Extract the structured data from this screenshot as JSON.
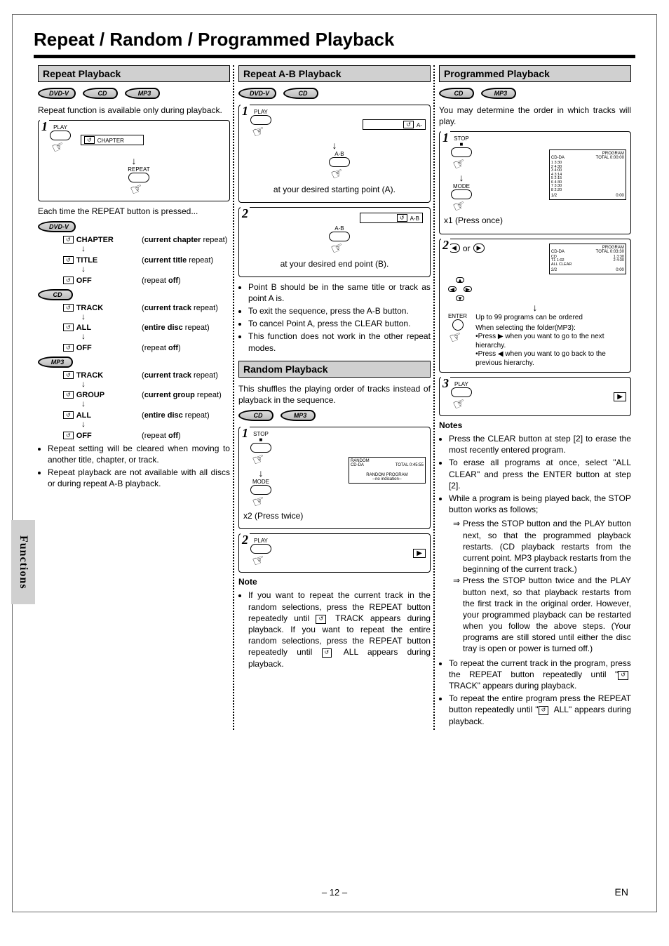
{
  "page": {
    "title": "Repeat / Random / Programmed Playback",
    "number": "– 12 –",
    "lang": "EN"
  },
  "side_tab": "Functions",
  "badges": {
    "dvdv": "DVD-V",
    "cd": "CD",
    "mp3": "MP3"
  },
  "col1": {
    "header": "Repeat Playback",
    "intro": "Repeat function is available only during playback.",
    "btn_play": "PLAY",
    "btn_repeat": "REPEAT",
    "osd_chapter": "CHAPTER",
    "after_press": "Each time the REPEAT button is pressed...",
    "dvd_seq": [
      {
        "tag": "CHAPTER",
        "desc": "(current chapter repeat)"
      },
      {
        "tag": "TITLE",
        "desc": "(current title repeat)"
      },
      {
        "tag": "OFF",
        "desc": "(repeat off)"
      }
    ],
    "cd_seq": [
      {
        "tag": "TRACK",
        "desc": "(current track repeat)"
      },
      {
        "tag": "ALL",
        "desc": "(entire disc repeat)"
      },
      {
        "tag": "OFF",
        "desc": "(repeat off)"
      }
    ],
    "mp3_seq": [
      {
        "tag": "TRACK",
        "desc": "(current track repeat)"
      },
      {
        "tag": "GROUP",
        "desc": "(current group repeat)"
      },
      {
        "tag": "ALL",
        "desc": "(entire disc repeat)"
      },
      {
        "tag": "OFF",
        "desc": "(repeat off)"
      }
    ],
    "notes": [
      "Repeat setting will be cleared when moving to another title, chapter, or track.",
      "Repeat playback are not available with all discs or during repeat A-B playback."
    ]
  },
  "col2": {
    "header_ab": "Repeat A-B Playback",
    "btn_play": "PLAY",
    "btn_ab": "A-B",
    "osd_a": "A-",
    "osd_ab": "A-B",
    "step1_caption": "at your desired starting point (A).",
    "step2_caption": "at your desired end point (B).",
    "bullets_ab": [
      "Point B should be in the same title or track as point A is.",
      "To exit the sequence, press the A-B button.",
      "To cancel Point A, press the CLEAR button.",
      "This function does not work in the other repeat modes."
    ],
    "header_random": "Random Playback",
    "random_intro": "This shuffles the playing order of tracks instead of playback in the sequence.",
    "btn_stop": "STOP",
    "btn_mode": "MODE",
    "random_screen_title": "RANDOM",
    "random_screen_sub1": "CD-DA",
    "random_screen_total": "TOTAL 0:45:55",
    "random_screen_sub2": "RANDOM PROGRAM",
    "random_screen_sub3": "--no indication--",
    "x2": "x2 (Press twice)",
    "note_hdr": "Note",
    "note_body_1": "If you want to repeat the current track in the random selections, press the REPEAT button repeatedly until ",
    "note_body_2": " TRACK appears during playback. If you want to repeat the entire random selections, press the  REPEAT button repeatedly until ",
    "note_body_3": " ALL appears during playback."
  },
  "col3": {
    "header": "Programmed Playback",
    "intro": "You may determine the order in which tracks will play.",
    "btn_stop": "STOP",
    "btn_mode": "MODE",
    "btn_enter": "ENTER",
    "btn_play": "PLAY",
    "x1": "x1 (Press once)",
    "screen1": {
      "title": "PROGRAM",
      "sub": "CD-DA",
      "total": "TOTAL 0:00:00",
      "list": [
        "1   3:30",
        "2   4:30",
        "3   4:00",
        "4   3:14",
        "5   2:15",
        "6   4:30",
        "7   3:30",
        "8   2:20"
      ],
      "footer_l": "1/2",
      "footer_r": "0:00"
    },
    "up_to": "Up to 99 programs can be ordered",
    "mp3_hint_title": "When selecting the folder(MP3):",
    "mp3_hint_1": "•Press ▶ when you want to go to the next hierarchy.",
    "mp3_hint_2": "•Press ◀ when you want to go back to the previous hierarchy.",
    "screen2": {
      "title": "PROGRAM",
      "sub": "CD-DA",
      "total": "TOTAL 0:03:30",
      "rows": [
        "1   3:30",
        "2   4:30"
      ],
      "sum": "T1  1:02",
      "allclear": "ALL CLEAR",
      "footer_l": "2/2",
      "footer_r": "0:00"
    },
    "or": "or",
    "notes_hdr": "Notes",
    "notes": [
      "Press the CLEAR button at step [2] to erase the most recently entered program.",
      "To erase all programs at once, select \"ALL CLEAR\" and press the ENTER button at step [2].",
      "While a program is being played back, the STOP button works as follows;"
    ],
    "arrow_notes": [
      "Press the STOP button and the PLAY button next, so that the programmed playback restarts. (CD playback restarts from the current point. MP3 playback restarts from the beginning of the current track.)",
      "Press the STOP button twice and the PLAY button next, so that playback restarts from the first track in the original order. However, your programmed playback can be restarted when you follow the above steps. (Your programs are still stored until either the disc tray is open or power is turned off.)"
    ],
    "notes2": [
      "To repeat the current track in the program, press the REPEAT button repeatedly until \"  TRACK\" appears during playback.",
      "To repeat the entire program press the REPEAT button repeatedly until \"  ALL\" appears during playback."
    ]
  }
}
